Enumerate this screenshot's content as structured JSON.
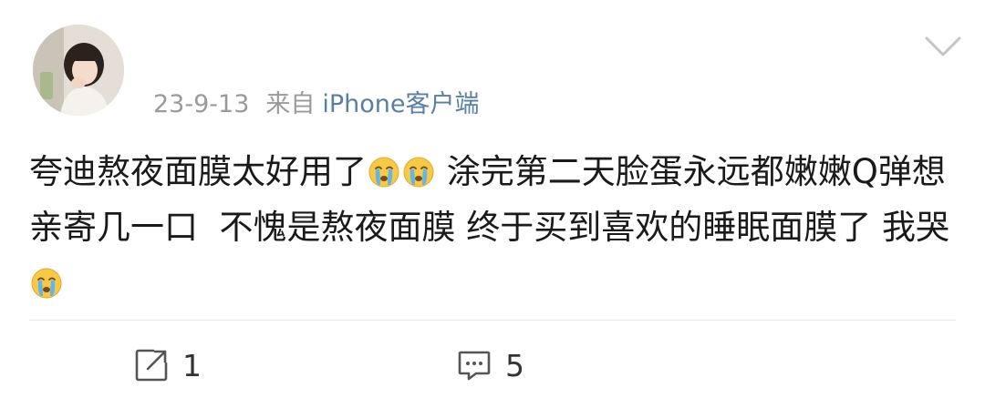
{
  "post": {
    "date": "23-9-13",
    "from_label": "来自",
    "source": "iPhone客户端",
    "text_segments": [
      {
        "type": "text",
        "value": "夸迪熬夜面膜太好用了"
      },
      {
        "type": "emoji",
        "name": "crying-emoji"
      },
      {
        "type": "emoji",
        "name": "crying-emoji"
      },
      {
        "type": "text",
        "value": " 涂完第二天脸蛋永远都嫩嫩Q弹想亲寄几一口  不愧是熬夜面膜 终于买到喜欢的睡眠面膜了 我哭"
      },
      {
        "type": "emoji",
        "name": "crying-emoji"
      }
    ]
  },
  "actions": {
    "repost_count": "1",
    "comment_count": "5"
  }
}
